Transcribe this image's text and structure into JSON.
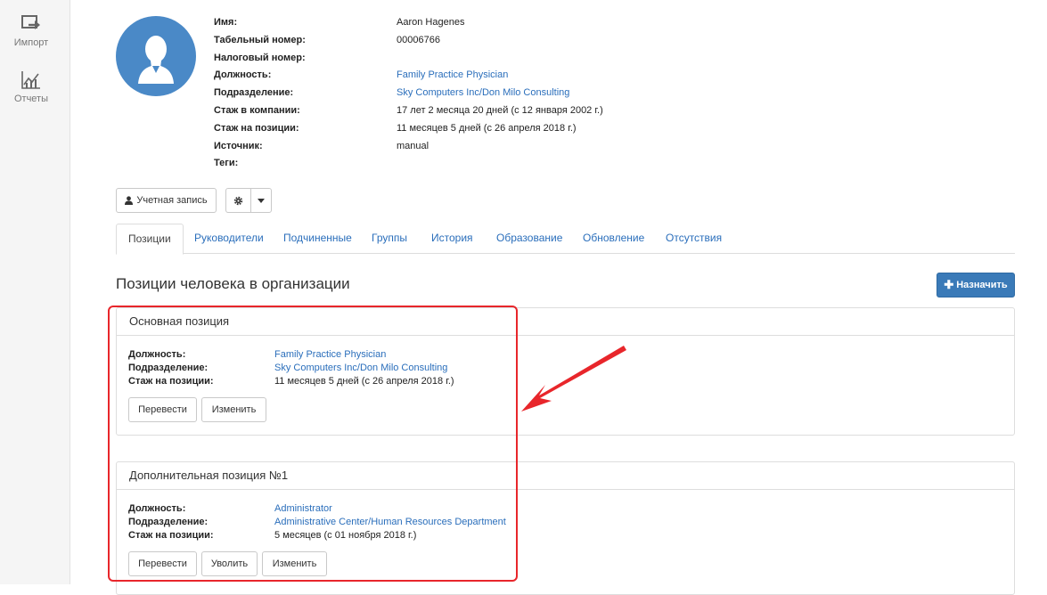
{
  "sidebar": {
    "items": [
      {
        "label": "Импорт",
        "icon": "import-icon"
      },
      {
        "label": "Отчеты",
        "icon": "reports-chart-icon"
      }
    ]
  },
  "profile": {
    "avatar_icon": "user-avatar-icon",
    "fields": [
      {
        "label": "Имя:",
        "value": "Aaron Hagenes",
        "link": false
      },
      {
        "label": "Табельный номер:",
        "value": "00006766",
        "link": false
      },
      {
        "label": "Налоговый номер:",
        "value": "",
        "link": false
      },
      {
        "label": "Должность:",
        "value": "Family Practice Physician",
        "link": true
      },
      {
        "label": "Подразделение:",
        "value": "Sky Computers Inc/Don Milo Consulting",
        "link": true
      },
      {
        "label": "Стаж в компании:",
        "value": "17 лет 2 месяца 20 дней (с 12 января 2002 г.)",
        "link": false
      },
      {
        "label": "Стаж на позиции:",
        "value": "11 месяцев 5 дней (с 26 апреля 2018 г.)",
        "link": false
      },
      {
        "label": "Источник:",
        "value": "manual",
        "link": false
      },
      {
        "label": "Теги:",
        "value": "",
        "link": false
      }
    ]
  },
  "actions": {
    "account_label": "Учетная запись",
    "settings_icon": "gear-icon",
    "caret_icon": "caret-down-icon"
  },
  "tabs": [
    {
      "label": "Позиции",
      "active": true
    },
    {
      "label": "Руководители",
      "active": false
    },
    {
      "label": "Подчиненные",
      "active": false
    },
    {
      "label": "Группы",
      "active": false
    },
    {
      "label": "История",
      "active": false
    },
    {
      "label": "Образование",
      "active": false
    },
    {
      "label": "Обновление",
      "active": false
    },
    {
      "label": "Отсутствия",
      "active": false
    }
  ],
  "section": {
    "title": "Позиции человека в организации",
    "assign_label": "Назначить"
  },
  "positions": [
    {
      "title": "Основная позиция",
      "rows": [
        {
          "label": "Должность:",
          "value": "Family Practice Physician",
          "link": true
        },
        {
          "label": "Подразделение:",
          "value": "Sky Computers Inc/Don Milo Consulting",
          "link": true
        },
        {
          "label": "Стаж на позиции:",
          "value": "11 месяцев 5 дней (с 26 апреля 2018 г.)",
          "link": false
        }
      ],
      "buttons": [
        "Перевести",
        "Изменить"
      ]
    },
    {
      "title": "Дополнительная позиция №1",
      "rows": [
        {
          "label": "Должность:",
          "value": "Administrator",
          "link": true
        },
        {
          "label": "Подразделение:",
          "value": "Administrative Center/Human Resources Department",
          "link": true
        },
        {
          "label": "Стаж на позиции:",
          "value": "5 месяцев (с 01 ноября 2018 г.)",
          "link": false
        }
      ],
      "buttons": [
        "Перевести",
        "Уволить",
        "Изменить"
      ]
    }
  ],
  "colors": {
    "accent": "#2a6ebb",
    "primary_button": "#3a7ab8",
    "annotation": "#e8262b",
    "avatar_bg": "#4a89c7"
  }
}
